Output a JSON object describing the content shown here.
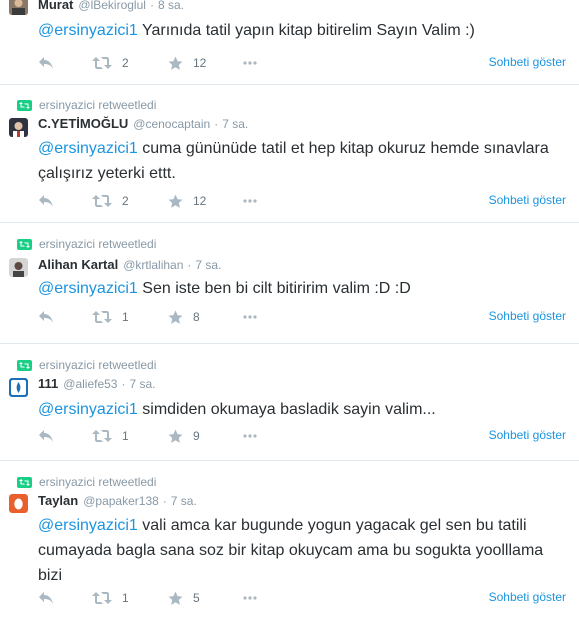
{
  "colors": {
    "accent": "#1b95e0",
    "retweet": "#19cf86",
    "muted": "#8899a6"
  },
  "tweets": [
    {
      "context": "",
      "name": "Murat",
      "handle": "@lBekiroglul",
      "time": "8 sa.",
      "mention": "@ersinyazici1",
      "text": " Yarınıda tatil yapın kitap  bitirelim Sayın Valim :)",
      "retweets": "2",
      "favorites": "12",
      "conversation": "Sohbeti göster"
    },
    {
      "context": "ersinyazici retweetledi",
      "name": "C.YETİMOĞLU",
      "handle": "@cenocaptain",
      "time": "7 sa.",
      "mention": "@ersinyazici1",
      "text": " cuma gününüde tatil et hep kitap okuruz hemde sınavlara çalışırız yeterki ettt.",
      "retweets": "2",
      "favorites": "12",
      "conversation": "Sohbeti göster"
    },
    {
      "context": "ersinyazici retweetledi",
      "name": "Alihan Kartal",
      "handle": "@krtlalihan",
      "time": "7 sa.",
      "mention": "@ersinyazici1",
      "text": " Sen iste ben bi cilt bitiririm valim :D :D",
      "retweets": "1",
      "favorites": "8",
      "conversation": "Sohbeti göster"
    },
    {
      "context": "ersinyazici retweetledi",
      "name": "111",
      "handle": "@aliefe53",
      "time": "7 sa.",
      "mention": "@ersinyazici1",
      "text": " simdiden okumaya basladik sayin valim...",
      "retweets": "1",
      "favorites": "9",
      "conversation": "Sohbeti göster"
    },
    {
      "context": "ersinyazici retweetledi",
      "name": "Taylan",
      "handle": "@papaker138",
      "time": "7 sa.",
      "mention": "@ersinyazici1",
      "text": " vali amca kar bugunde yogun yagacak gel sen bu tatili cumayada bagla sana soz bir kitap okuycam ama bu sogukta yoolllama bizi",
      "retweets": "1",
      "favorites": "5",
      "conversation": "Sohbeti göster"
    }
  ]
}
